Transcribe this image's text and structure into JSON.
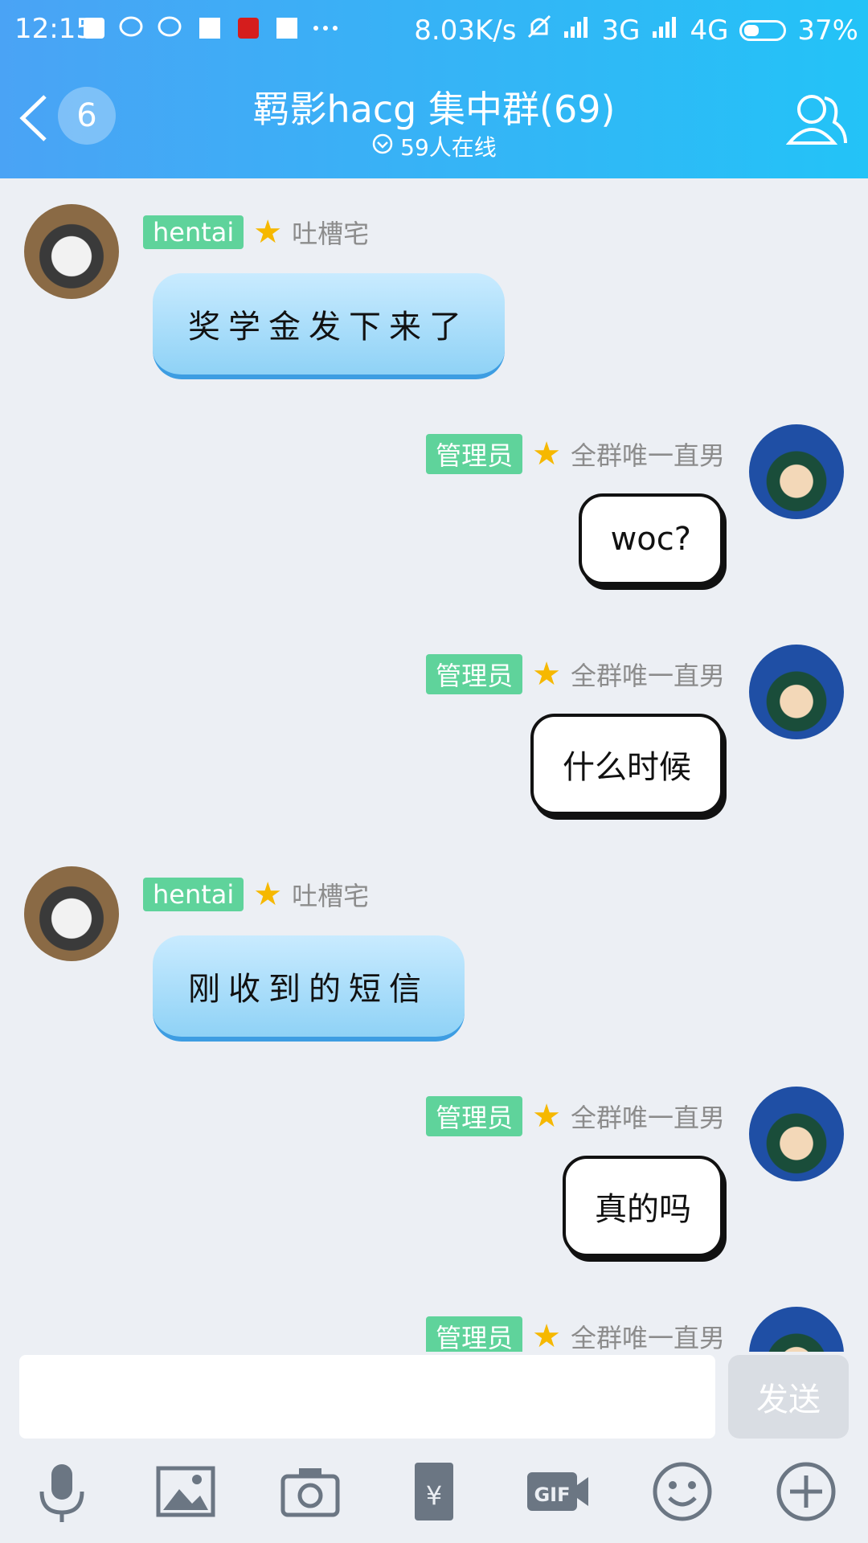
{
  "status": {
    "time": "12:15",
    "speed": "8.03K/s",
    "net3g": "3G",
    "net4g": "4G",
    "battery": "37%"
  },
  "header": {
    "unread": "6",
    "title": "羁影hacg 集中群(69)",
    "online": "59人在线"
  },
  "messages": [
    {
      "side": "left",
      "tag": "hentai",
      "nickname": "吐槽宅",
      "text": "奖学金发下来了"
    },
    {
      "side": "right",
      "tag": "管理员",
      "nickname": "全群唯一直男",
      "text": "woc?"
    },
    {
      "side": "right",
      "tag": "管理员",
      "nickname": "全群唯一直男",
      "text": "什么时候"
    },
    {
      "side": "left",
      "tag": "hentai",
      "nickname": "吐槽宅",
      "text": "刚收到的短信"
    },
    {
      "side": "right",
      "tag": "管理员",
      "nickname": "全群唯一直男",
      "text": "真的吗"
    },
    {
      "side": "right",
      "tag": "管理员",
      "nickname": "全群唯一直男",
      "text": ""
    }
  ],
  "composer": {
    "send_label": "发送"
  },
  "toolbar_icons": [
    "microphone-icon",
    "image-icon",
    "camera-icon",
    "red-packet-icon",
    "gif-icon",
    "emoji-icon",
    "plus-icon"
  ],
  "colors": {
    "header_start": "#4aa3f5",
    "header_end": "#23c3f7",
    "tag_green": "#5fd39b",
    "background": "#eceff4"
  }
}
